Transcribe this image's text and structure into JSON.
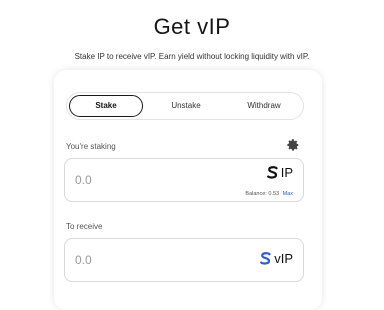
{
  "header": {
    "title": "Get vIP",
    "subtitle": "Stake IP to receive vIP. Earn yield without locking liquidity with vIP."
  },
  "tabs": [
    {
      "label": "Stake",
      "active": true
    },
    {
      "label": "Unstake",
      "active": false
    },
    {
      "label": "Withdraw",
      "active": false
    }
  ],
  "staking": {
    "label": "You're staking",
    "amount": "0.0",
    "token": "IP",
    "balance_label": "Balance:",
    "balance_value": "0.53",
    "max_label": "Max"
  },
  "receive": {
    "label": "To receive",
    "amount": "0.0",
    "token": "vIP"
  },
  "colors": {
    "accent": "#2f5bd3",
    "border": "#d9d9d9",
    "tab_active_border": "#1c1c1c"
  }
}
